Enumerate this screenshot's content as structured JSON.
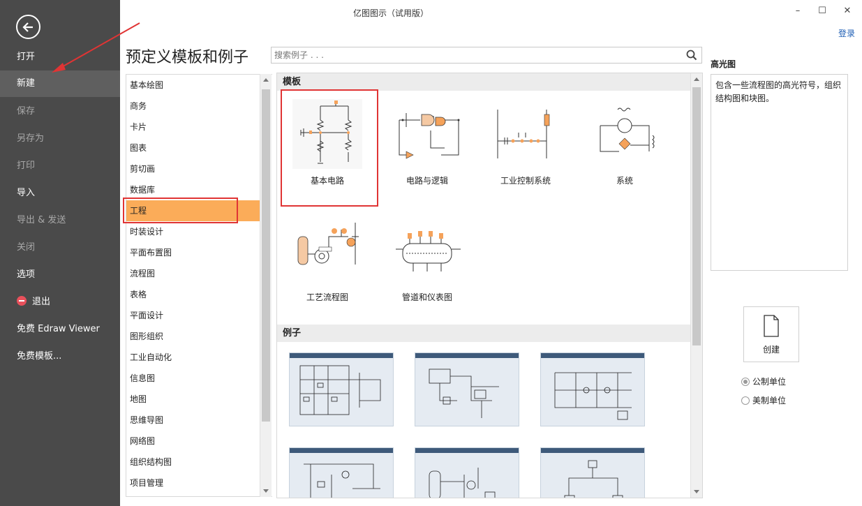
{
  "window": {
    "title": "亿图图示（试用版）",
    "minimize": "–",
    "maximize": "☐",
    "close": "✕",
    "login": "登录"
  },
  "sidebar": {
    "items": [
      {
        "label": "打开"
      },
      {
        "label": "新建"
      },
      {
        "label": "保存"
      },
      {
        "label": "另存为"
      },
      {
        "label": "打印"
      },
      {
        "label": "导入"
      },
      {
        "label": "导出 & 发送"
      },
      {
        "label": "关闭"
      },
      {
        "label": "选项"
      },
      {
        "label": "退出"
      },
      {
        "label": "免费 Edraw Viewer"
      },
      {
        "label": "免费模板..."
      }
    ]
  },
  "main": {
    "title": "预定义模板和例子",
    "search_placeholder": "搜索例子 . . ."
  },
  "categories": {
    "items": [
      {
        "label": "基本绘图"
      },
      {
        "label": "商务"
      },
      {
        "label": "卡片"
      },
      {
        "label": "图表"
      },
      {
        "label": "剪切画"
      },
      {
        "label": "数据库"
      },
      {
        "label": "工程"
      },
      {
        "label": "时装设计"
      },
      {
        "label": "平面布置图"
      },
      {
        "label": "流程图"
      },
      {
        "label": "表格"
      },
      {
        "label": "平面设计"
      },
      {
        "label": "图形组织"
      },
      {
        "label": "工业自动化"
      },
      {
        "label": "信息图"
      },
      {
        "label": "地图"
      },
      {
        "label": "思维导图"
      },
      {
        "label": "网络图"
      },
      {
        "label": "组织结构图"
      },
      {
        "label": "项目管理"
      }
    ],
    "selected": "工程"
  },
  "gallery": {
    "templates_header": "模板",
    "examples_header": "例子",
    "templates": [
      {
        "label": "基本电路"
      },
      {
        "label": "电路与逻辑"
      },
      {
        "label": "工业控制系统"
      },
      {
        "label": "系统"
      },
      {
        "label": "工艺流程图"
      },
      {
        "label": "管道和仪表图"
      }
    ]
  },
  "preview": {
    "title": "高光图",
    "description": "包含一些流程图的高光符号，组织结构图和块图。"
  },
  "create": {
    "label": "创建"
  },
  "units": {
    "metric": "公制单位",
    "us": "美制单位",
    "selected": "公制单位"
  },
  "colors": {
    "sidebar_bg": "#4a4a4a",
    "selected_category": "#fbac59",
    "highlight": "#e03434",
    "accent_orange": "#f5a25a"
  }
}
